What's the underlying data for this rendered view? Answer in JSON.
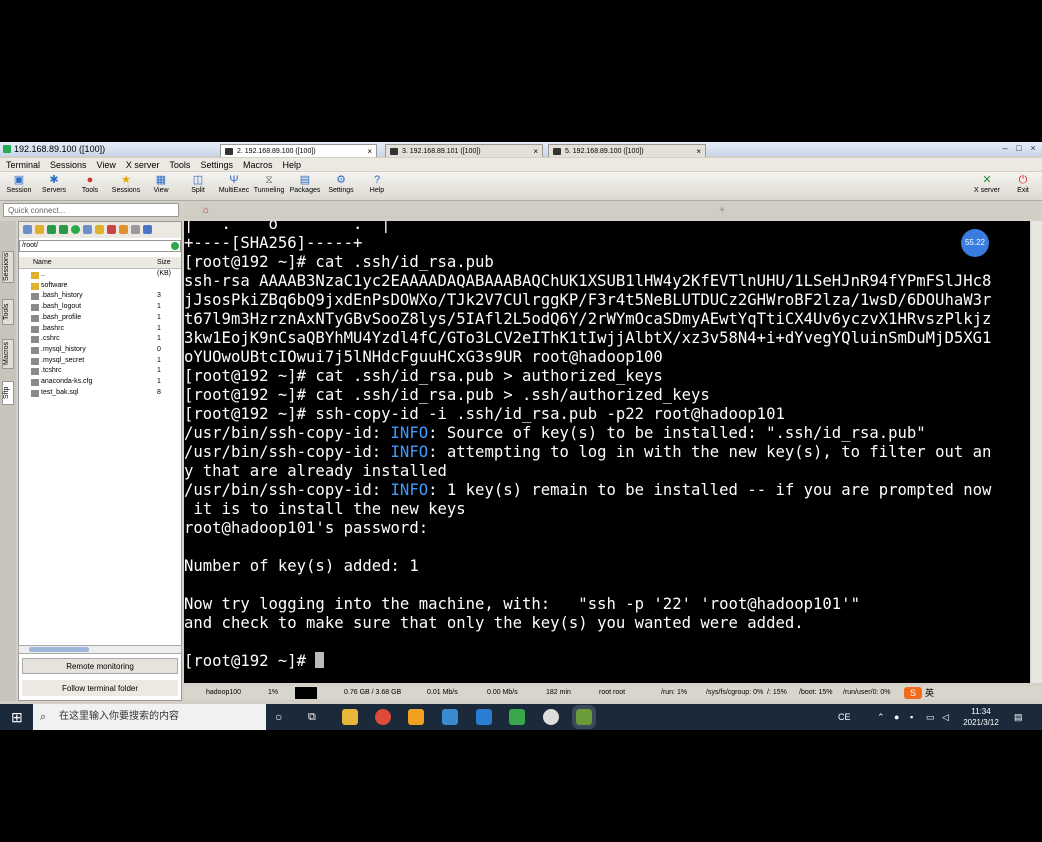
{
  "window": {
    "title": "192.168.89.100 ([100])"
  },
  "menu": [
    "Terminal",
    "Sessions",
    "View",
    "X server",
    "Tools",
    "Settings",
    "Macros",
    "Help"
  ],
  "toolbar": {
    "left": [
      "Session",
      "Servers",
      "Tools",
      "Sessions",
      "View",
      "Split",
      "MultiExec",
      "Tunneling",
      "Packages",
      "Settings",
      "Help"
    ],
    "right": [
      "X server",
      "Exit"
    ]
  },
  "quick_connect": {
    "placeholder": "Quick connect..."
  },
  "tabs": [
    "2. 192.168.89.100 ([100])",
    "3. 192.168.89.101 ([100])",
    "5. 192.168.89.100 ([100])"
  ],
  "side_tabs": [
    "Sessions",
    "Tools",
    "Macros",
    "Sftp"
  ],
  "file_panel": {
    "path": "/root/",
    "col_name": "Name",
    "col_size": "Size (KB)",
    "files": [
      {
        "name": "..",
        "size": ""
      },
      {
        "name": "software",
        "size": ""
      },
      {
        "name": ".bash_history",
        "size": "3"
      },
      {
        "name": ".bash_logout",
        "size": "1"
      },
      {
        "name": ".bash_profile",
        "size": "1"
      },
      {
        "name": ".bashrc",
        "size": "1"
      },
      {
        "name": ".cshrc",
        "size": "1"
      },
      {
        "name": ".mysql_history",
        "size": "0"
      },
      {
        "name": ".mysql_secret",
        "size": "1"
      },
      {
        "name": ".tcshrc",
        "size": "1"
      },
      {
        "name": "anaconda-ks.cfg",
        "size": "1"
      },
      {
        "name": "test_bak.sql",
        "size": "8"
      }
    ],
    "remote_monitoring": "Remote monitoring",
    "follow_folder": "Follow terminal folder"
  },
  "terminal": {
    "lines": [
      "|   .    o        .  |",
      "+----[SHA256]-----+",
      "[root@192 ~]# cat .ssh/id_rsa.pub",
      "ssh-rsa AAAAB3NzaC1yc2EAAAADAQABAAABAQChUK1XSUB1lHW4y2KfEVTlnUHU/1LSeHJnR94fYPmFSlJHc8",
      "jJsosPkiZBq6bQ9jxdEnPsDOWXo/TJk2V7CUlrggKP/F3r4t5NeBLUTDUCz2GHWroBF2lza/1wsD/6DOUhaW3r",
      "t67l9m3HzrznAxNTyGBvSooZ8lys/5IAfl2L5odQ6Y/2rWYmOcaSDmyAEwtYqTtiCX4Uv6yczvX1HRvszPlkjz",
      "3kw1EojK9nCsaQBYhMU4Yzdl4fC/GTo3LCV2eIThK1tIwjjAlbtX/xz3v58N4+i+dYvegYQluinSmDuMjD5XG1",
      "oYUOwoUBtcIOwui7j5lNHdcFguuHCxG3s9UR root@hadoop100",
      "[root@192 ~]# cat .ssh/id_rsa.pub > authorized_keys",
      "[root@192 ~]# cat .ssh/id_rsa.pub > .ssh/authorized_keys",
      "[root@192 ~]# ssh-copy-id -i .ssh/id_rsa.pub -p22 root@hadoop101",
      "/usr/bin/ssh-copy-id: |INFO|: Source of key(s) to be installed: \".ssh/id_rsa.pub\"",
      "/usr/bin/ssh-copy-id: |INFO|: attempting to log in with the new key(s), to filter out an",
      "y that are already installed",
      "/usr/bin/ssh-copy-id: |INFO|: 1 key(s) remain to be installed -- if you are prompted now",
      " it is to install the new keys",
      "root@hadoop101's password:",
      "",
      "Number of key(s) added: 1",
      "",
      "Now try logging into the machine, with:   \"ssh -p '22' 'root@hadoop101'\"",
      "and check to make sure that only the key(s) you wanted were added.",
      "",
      "[root@192 ~]# "
    ],
    "badge": "55.22"
  },
  "status": [
    "hadoop100",
    "1%",
    "0.76 GB / 3.68 GB",
    "0.01 Mb/s",
    "0.00 Mb/s",
    "182 min",
    "root  root",
    "/run: 1%",
    "/sys/fs/cgroup: 0%",
    "/: 15%",
    "/boot: 15%",
    "/run/user/0: 0%"
  ],
  "taskbar": {
    "search_placeholder": "在这里输入你要搜索的内容",
    "time": "11:34",
    "date": "2021/3/12",
    "ime": "英"
  }
}
